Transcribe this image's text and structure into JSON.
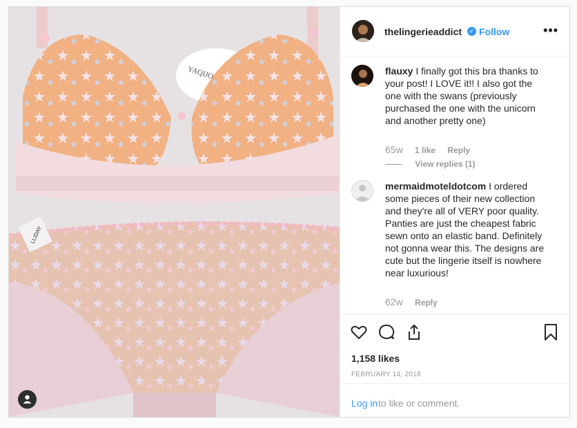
{
  "post": {
    "author": "thelingerieaddict",
    "follow_label": "Follow",
    "more_icon": "more-horizontal-icon",
    "image_tag_1": "YAQIJOH IMIHM",
    "image_tag_2": "LLIDAY"
  },
  "comments": [
    {
      "username": "flauxy",
      "text": "I finally got this bra thanks to your post! I LOVE it!! I also got the one with the swans (previously purchased the one with the unicorn and another pretty one)",
      "age": "65w",
      "likes": "1 like",
      "reply_label": "Reply",
      "view_replies": "View replies (1)"
    },
    {
      "username": "mermaidmoteldotcom",
      "text": "I ordered some pieces of their new collection and they're all of VERY poor quality. Panties are just the cheapest fabric sewn onto an elastic band. Definitely not gonna wear this. The designs are cute but the lingerie itself is nowhere near luxurious!",
      "age": "62w",
      "reply_label": "Reply"
    }
  ],
  "engagement": {
    "likes": "1,158 likes",
    "date": "FEBRUARY 14, 2018"
  },
  "login": {
    "link": "Log in",
    "rest": "to like or comment."
  },
  "colors": {
    "link": "#3897f0",
    "text": "#262626",
    "muted": "#999999",
    "border": "#efefef"
  }
}
